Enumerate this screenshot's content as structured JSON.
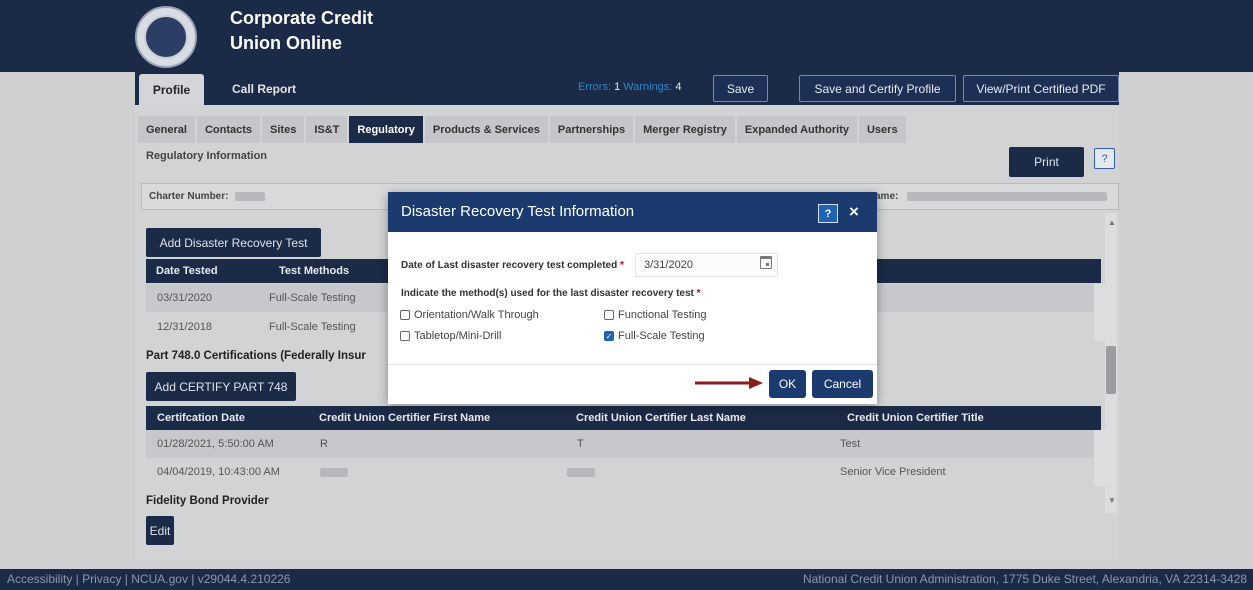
{
  "header": {
    "title_line1": "Corporate Credit",
    "title_line2": "Union Online"
  },
  "nav": {
    "profile_tab": "Profile",
    "call_report_tab": "Call Report",
    "errors_label": "Errors:",
    "errors_count": "1",
    "warnings_label": "Warnings:",
    "warnings_count": "4",
    "save": "Save",
    "save_certify": "Save and Certify Profile",
    "view_print": "View/Print Certified PDF"
  },
  "subtabs": [
    "General",
    "Contacts",
    "Sites",
    "IS&T",
    "Regulatory",
    "Products & Services",
    "Partnerships",
    "Merger Registry",
    "Expanded Authority",
    "Users"
  ],
  "active_subtab": "Regulatory",
  "page": {
    "section_title": "Regulatory Information",
    "print": "Print",
    "help": "?",
    "charter_label": "Charter Number:",
    "name_label": "ame:"
  },
  "dr_section": {
    "add_button": "Add Disaster Recovery Test",
    "headers": [
      "Date Tested",
      "Test Methods"
    ],
    "rows": [
      [
        "03/31/2020",
        "Full-Scale Testing"
      ],
      [
        "12/31/2018",
        "Full-Scale Testing"
      ]
    ]
  },
  "cert_section": {
    "heading": "Part 748.0 Certifications (Federally Insur",
    "add_button": "Add CERTIFY PART 748",
    "headers": [
      "Certifcation Date",
      "Credit Union Certifier First Name",
      "Credit Union Certifier Last Name",
      "Credit Union Certifier Title"
    ],
    "rows": [
      [
        "01/28/2021, 5:50:00 AM",
        "R",
        "T",
        "Test"
      ],
      [
        "04/04/2019, 10:43:00 AM",
        "",
        "",
        "Senior Vice President"
      ]
    ]
  },
  "fidelity": {
    "heading": "Fidelity Bond Provider",
    "edit": "Edit"
  },
  "modal": {
    "title": "Disaster Recovery Test Information",
    "help": "?",
    "close": "×",
    "date_label": "Date of Last disaster recovery test completed",
    "date_value": "3/31/2020",
    "methods_label": "Indicate the method(s) used for the last disaster recovery test",
    "required_mark": "*",
    "options": [
      {
        "label": "Orientation/Walk Through",
        "checked": false
      },
      {
        "label": "Functional Testing",
        "checked": false
      },
      {
        "label": "Tabletop/Mini-Drill",
        "checked": false
      },
      {
        "label": "Full-Scale Testing",
        "checked": true
      }
    ],
    "ok": "OK",
    "cancel": "Cancel"
  },
  "footer": {
    "left": "Accessibility | Privacy | NCUA.gov | v29044.4.210226",
    "right": "National Credit Union Administration, 1775 Duke Street, Alexandria, VA 22314-3428"
  },
  "colors": {
    "navy": "#1b2a46",
    "modal_header": "#1b3b6e",
    "checkbox_blue": "#1f63b4",
    "arrow_red": "#8b1a1a",
    "required_red": "#d0021b"
  }
}
